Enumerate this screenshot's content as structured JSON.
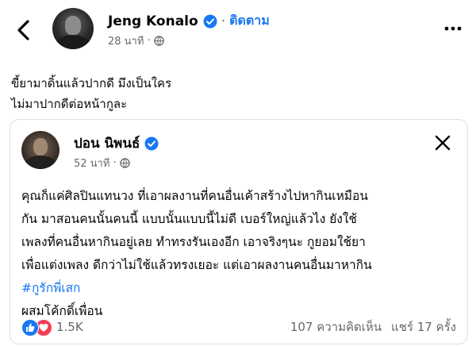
{
  "header": {
    "author": "Jeng Konalo",
    "follow_label": "ติดตาม",
    "time": "28 นาที",
    "icons": [
      "back-arrow-icon",
      "verified-badge-icon",
      "globe-icon",
      "more-options-icon"
    ]
  },
  "caption": {
    "lines": [
      "ขี้ยามาดิ้นแล้วปากดี   มึงเป็นใคร",
      "ไม่มาปากดีต่อหน้ากูละ"
    ]
  },
  "shared_post": {
    "author": "ปอน นิพนธ์",
    "time": "52 นาที",
    "lines": [
      "คุณก็แค่ศิลปินแทนวง ที่เอาผลงานที่คนอื่นเค้าสร้างไปหากินเหมือน",
      "กัน มาสอนคนนั้นคนนี้ แบบนั้นแบบนี้ไม่ดี เบอร์ใหญ่แล้วไง ยังใช้",
      "เพลงที่คนอื่นหากินอยู่เลย ทำทรงรันเองอีก เอาจริงๆนะ กูยอมใช้ยา",
      "เพื่อแต่งเพลง ดีกว่าไม่ใช้แล้วทรงเยอะ แต่เอาผลงานคนอื่นมาหากิน"
    ],
    "hashtag": "#กูรักพี่เสก",
    "last_line": "ผสมโค้กดิ์เพื่อน",
    "reaction_count": "1.5K",
    "comments": "107 ความคิดเห็น",
    "shares": "แชร์ 17 ครั้ง",
    "icons": [
      "close-icon",
      "like-reaction-icon",
      "love-reaction-icon"
    ]
  },
  "colors": {
    "accent": "#1877f2",
    "love": "#f33e58",
    "secondary_text": "#65676b"
  }
}
